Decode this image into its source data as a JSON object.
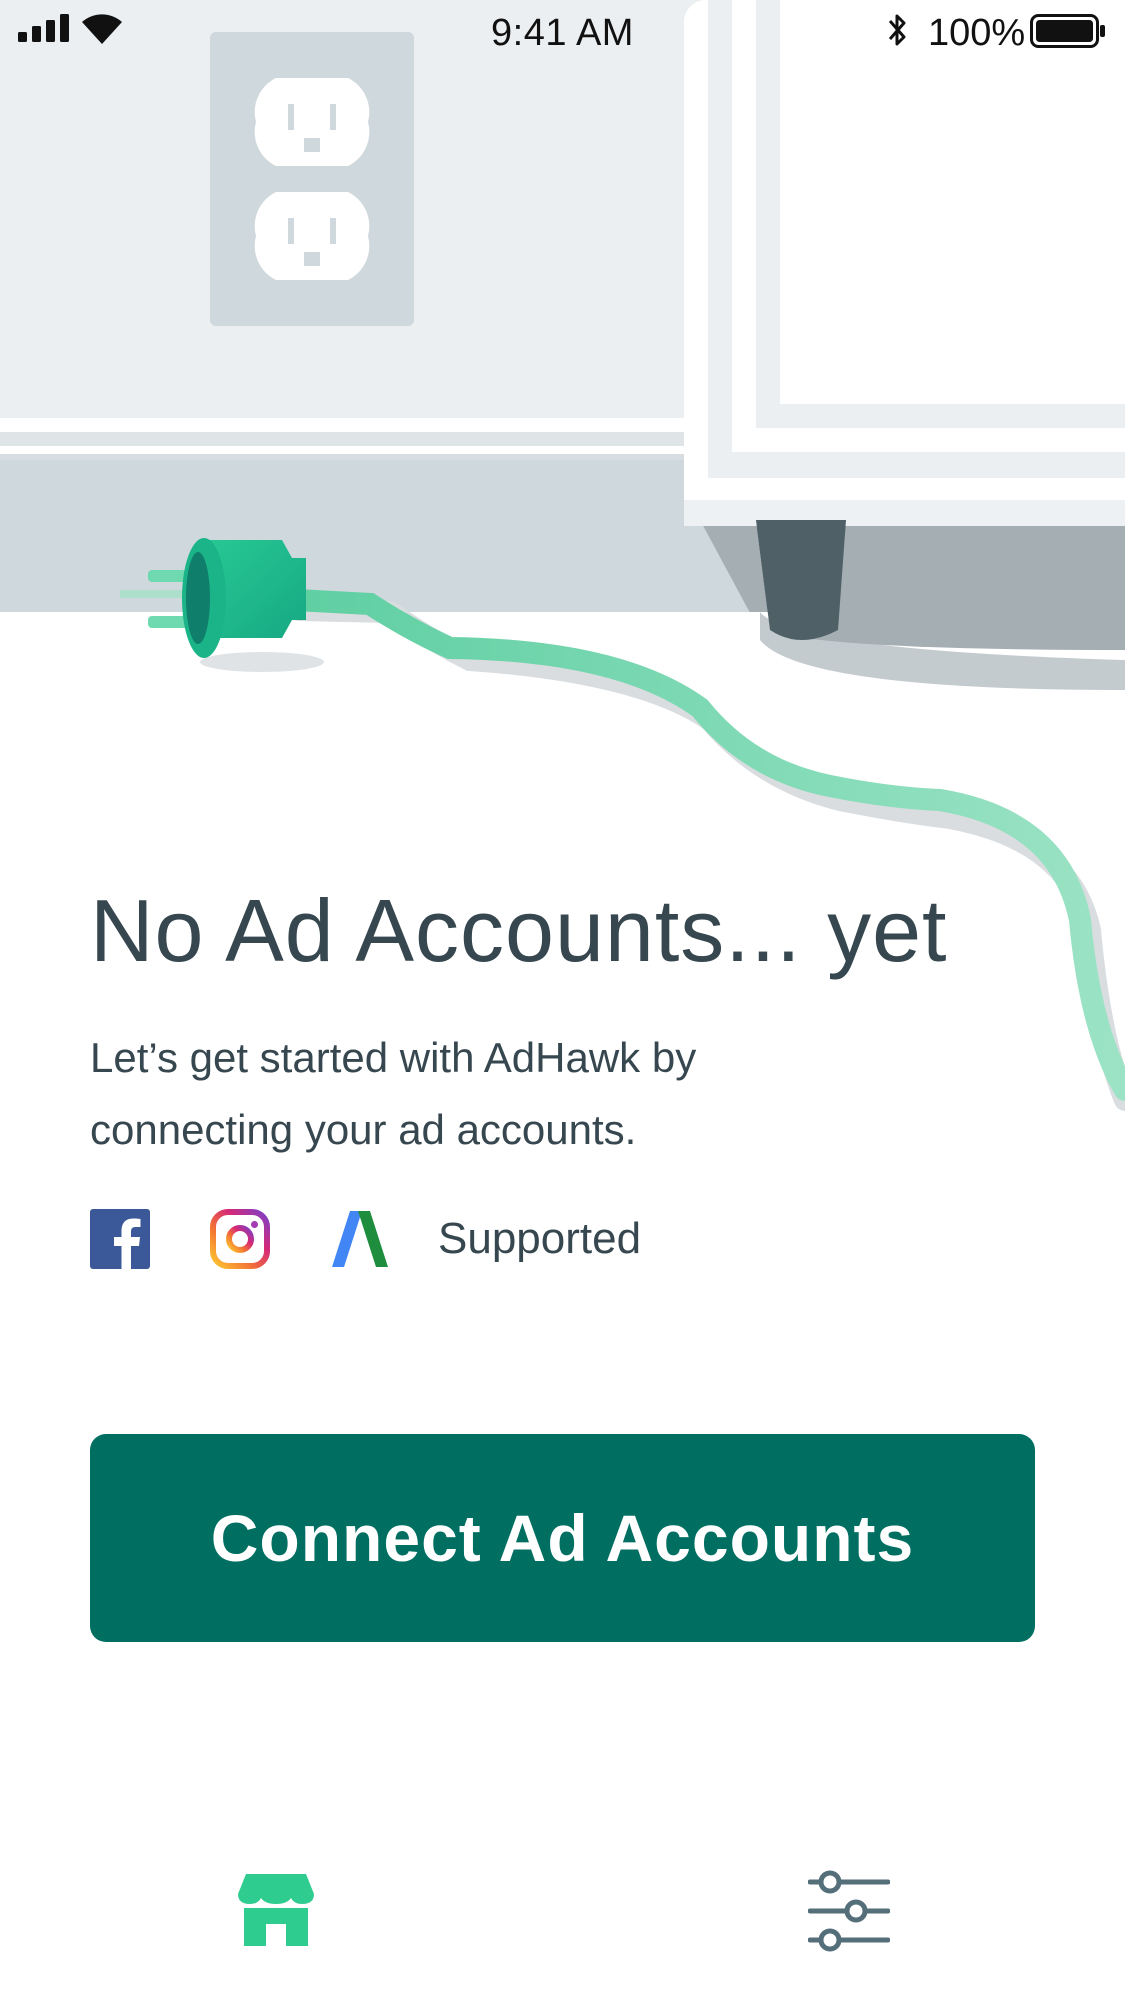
{
  "status_bar": {
    "time": "9:41 AM",
    "battery": "100%",
    "icons": [
      "signal-icon",
      "wifi-icon",
      "bluetooth-icon",
      "battery-icon"
    ]
  },
  "empty_state": {
    "title": "No Ad Accounts... yet",
    "subtitle": "Let’s get started with AdHawk by connecting your ad accounts.",
    "supported_label": "Supported",
    "platforms": [
      "facebook-icon",
      "instagram-icon",
      "google-ads-icon"
    ]
  },
  "primary_action": {
    "label": "Connect Ad Accounts"
  },
  "tab_bar": {
    "tabs": [
      {
        "icon": "storefront-icon",
        "active": true
      },
      {
        "icon": "sliders-icon",
        "active": false
      }
    ]
  },
  "colors": {
    "primary": "#006f62",
    "accent_green": "#2ecc8e",
    "text": "#37474f",
    "wall": "#eceff1"
  }
}
